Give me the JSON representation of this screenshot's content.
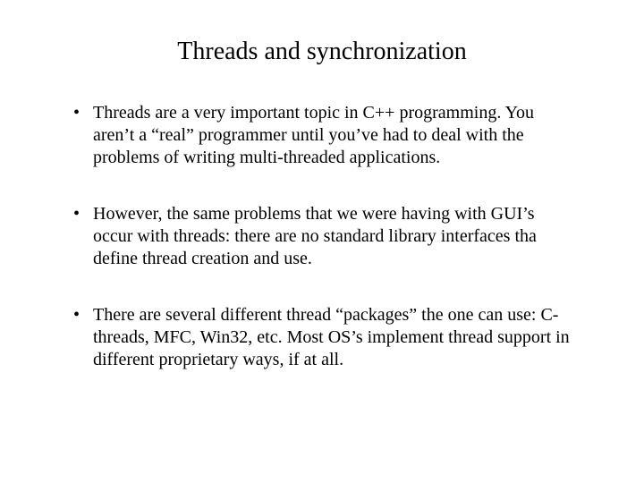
{
  "title": "Threads and synchronization",
  "bullets": [
    "Threads are a very important topic in C++ programming.  You aren’t a “real” programmer until you’ve had to deal with the problems of writing multi-threaded applications.",
    "However, the same problems that we were having with GUI’s occur with threads:  there are no standard library interfaces tha define thread creation and use.",
    "There are several different thread “packages” the one can use:  C-threads, MFC, Win32, etc.  Most OS’s implement thread support in different proprietary ways, if at all."
  ]
}
